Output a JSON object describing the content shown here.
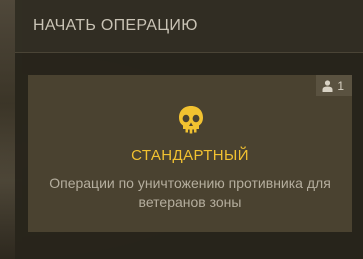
{
  "header": {
    "title": "НАЧАТЬ ОПЕРАЦИЮ"
  },
  "mode_card": {
    "players": "1",
    "players_icon": "person-icon",
    "mode_icon": "skull-icon",
    "name": "СТАНДАРТНЫЙ",
    "description": "Операции по уничтожению противника для ветеранов зоны",
    "accent_color": "#f2c230"
  }
}
